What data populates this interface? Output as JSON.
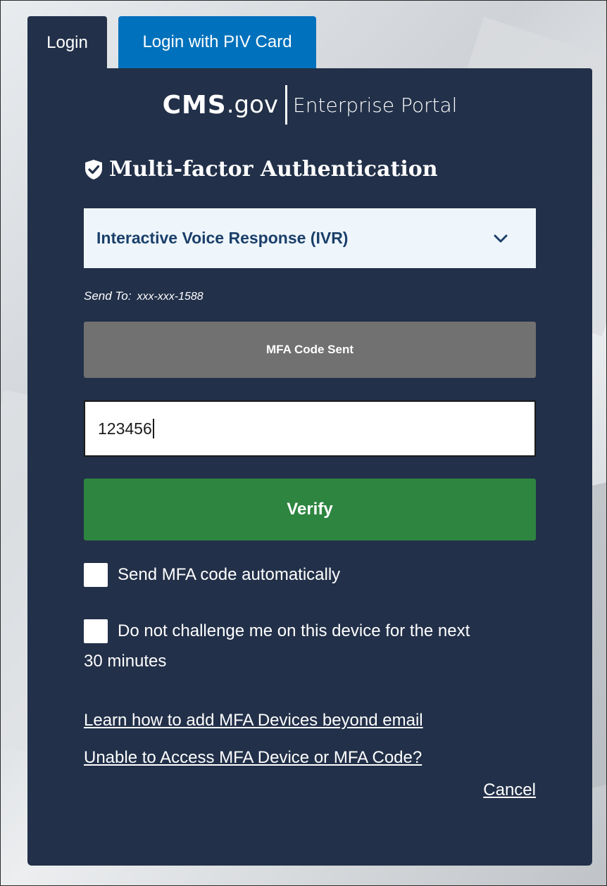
{
  "tabs": [
    {
      "label": "Login",
      "active": true
    },
    {
      "label": "Login with PIV Card",
      "active": false
    }
  ],
  "logo": {
    "cms": "CMS",
    "gov": ".gov",
    "portal": "Enterprise Portal"
  },
  "heading": {
    "text": "Multi-factor Authentication",
    "icon": "shield-check-icon"
  },
  "mfa_select": {
    "value": "Interactive Voice Response (IVR)",
    "icon": "chevron-down-icon"
  },
  "send_to": {
    "label": "Send To:",
    "number": "xxx-xxx-1588"
  },
  "mfa_sent_button": {
    "label": "MFA Code Sent"
  },
  "code_input": {
    "value": "123456"
  },
  "verify_button": {
    "label": "Verify"
  },
  "checkboxes": [
    {
      "label": "Send MFA code automatically",
      "checked": false
    },
    {
      "label": "Do not challenge me on this device for the next",
      "label_cont": "30 minutes",
      "checked": false
    }
  ],
  "links": {
    "add_devices": "Learn how to add MFA Devices beyond email",
    "unable_access": "Unable to Access MFA Device or MFA Code?",
    "cancel": "Cancel"
  },
  "colors": {
    "panel": "#223049",
    "piv_tab": "#0071bc",
    "verify": "#2e8540",
    "mfa_sent": "#717171",
    "select_bg": "#eef6fb"
  }
}
